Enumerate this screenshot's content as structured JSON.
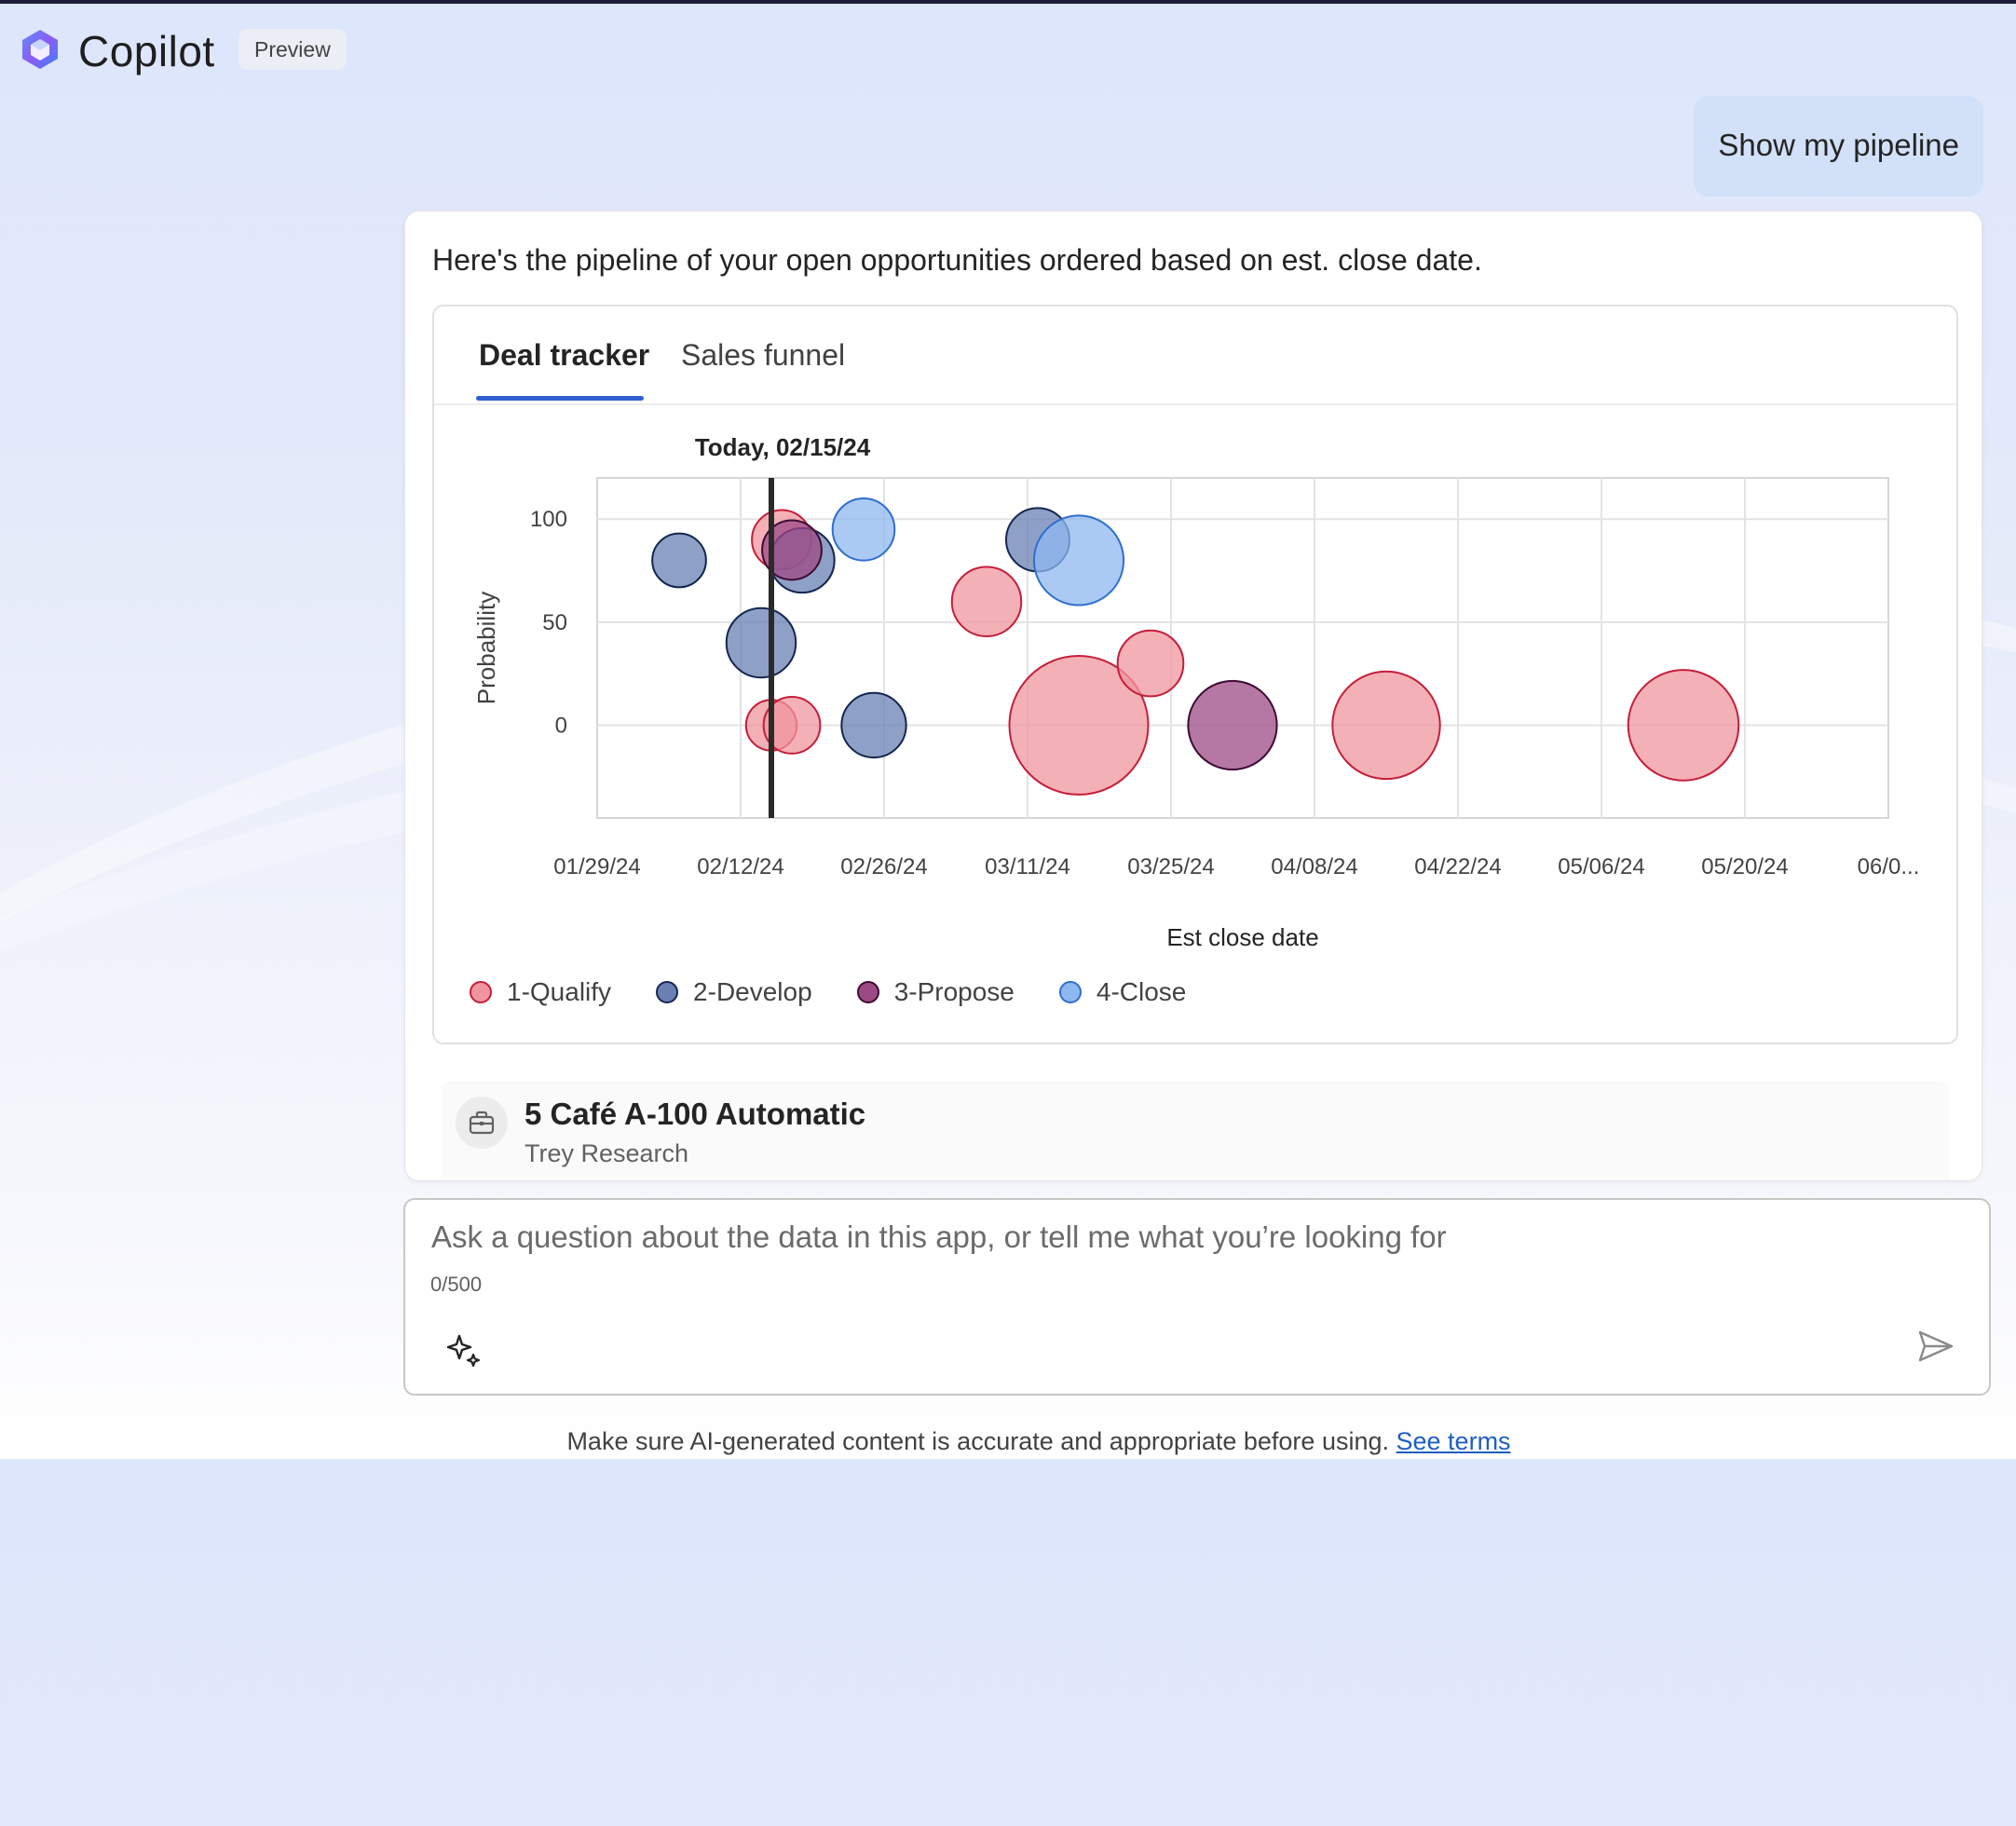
{
  "app": {
    "title": "Copilot",
    "badge": "Preview"
  },
  "user_message": "Show my pipeline",
  "response": {
    "text": "Here's the pipeline of your open opportunities ordered based on est. close date.",
    "tabs": [
      {
        "label": "Deal tracker",
        "active": true
      },
      {
        "label": "Sales funnel",
        "active": false
      }
    ]
  },
  "chart_data": {
    "type": "scatter",
    "subtype": "bubble",
    "xlabel": "Est close date",
    "ylabel": "Probability",
    "x_tick_labels": [
      "01/29/24",
      "02/12/24",
      "02/26/24",
      "03/11/24",
      "03/25/24",
      "04/08/24",
      "04/22/24",
      "05/06/24",
      "05/20/24",
      "06/0..."
    ],
    "y_tick_labels": [
      "100",
      "50",
      "0"
    ],
    "y_range": [
      -45,
      120
    ],
    "x_range": [
      "2024-01-29",
      "2024-06-03"
    ],
    "grid": true,
    "legend_position": "bottom-left",
    "today_marker": {
      "label": "Today, 02/15/24",
      "date": "2024-02-15"
    },
    "series": [
      {
        "name": "1-Qualify",
        "color": "#f0959f",
        "stroke": "#c41e3a",
        "points": [
          {
            "date": "2024-02-16",
            "y": 90,
            "size": 2.2
          },
          {
            "date": "2024-02-15",
            "y": 0,
            "size": 1.6
          },
          {
            "date": "2024-02-17",
            "y": 0,
            "size": 2.0
          },
          {
            "date": "2024-03-07",
            "y": 60,
            "size": 3.0
          },
          {
            "date": "2024-03-16",
            "y": 0,
            "size": 12.0
          },
          {
            "date": "2024-03-23",
            "y": 30,
            "size": 2.7
          },
          {
            "date": "2024-04-15",
            "y": 0,
            "size": 7.2
          },
          {
            "date": "2024-05-14",
            "y": 0,
            "size": 7.6
          }
        ]
      },
      {
        "name": "2-Develop",
        "color": "#6a80b3",
        "stroke": "#14264f",
        "points": [
          {
            "date": "2024-02-06",
            "y": 80,
            "size": 1.8
          },
          {
            "date": "2024-02-14",
            "y": 40,
            "size": 3.0
          },
          {
            "date": "2024-02-18",
            "y": 80,
            "size": 2.6
          },
          {
            "date": "2024-02-25",
            "y": 0,
            "size": 2.6
          },
          {
            "date": "2024-03-12",
            "y": 90,
            "size": 2.5
          }
        ]
      },
      {
        "name": "3-Propose",
        "color": "#9c4a84",
        "stroke": "#3d0b33",
        "points": [
          {
            "date": "2024-02-17",
            "y": 85,
            "size": 2.2
          },
          {
            "date": "2024-03-31",
            "y": 0,
            "size": 4.9
          }
        ]
      },
      {
        "name": "4-Close",
        "color": "#8eb8f0",
        "stroke": "#2f6fd0",
        "points": [
          {
            "date": "2024-02-24",
            "y": 95,
            "size": 2.4
          },
          {
            "date": "2024-03-16",
            "y": 80,
            "size": 5.0
          }
        ]
      }
    ]
  },
  "opportunity": {
    "title": "5 Café A-100 Automatic",
    "account": "Trey Research",
    "icon": "briefcase-icon"
  },
  "composer": {
    "placeholder": "Ask a question about the data in this app, or tell me what you’re looking for",
    "value": "",
    "counter": "0/500",
    "prompt_icon": "sparkle-icon",
    "send_icon": "send-icon"
  },
  "footer": {
    "disclaimer": "Make sure AI-generated content is accurate and appropriate before using.",
    "link_text": "See terms"
  }
}
